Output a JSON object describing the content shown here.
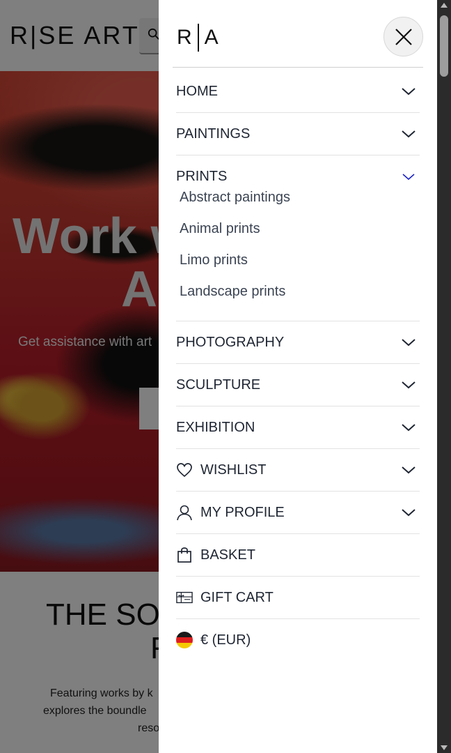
{
  "background": {
    "logo": "R|SE ART",
    "hero": {
      "title_line1": "Work w",
      "title_line2": "A",
      "subtitle": "Get assistance with art"
    },
    "section": {
      "title_line1": "THE SO",
      "title_line2": "F",
      "text_line1": "Featuring works by k",
      "text_line2": "explores the boundle",
      "text_line3": "reso"
    }
  },
  "drawer": {
    "logo_left": "R",
    "logo_right": "A",
    "close_icon": "close-icon",
    "menu": [
      {
        "label": "HOME",
        "icon": null,
        "expandable": true
      },
      {
        "label": "PAINTINGS",
        "icon": null,
        "expandable": true
      },
      {
        "label": "PRINTS",
        "icon": null,
        "expandable": true,
        "expanded": true,
        "children": [
          "Abstract paintings",
          "Animal prints",
          "Limo prints",
          "Landscape prints"
        ]
      },
      {
        "label": "PHOTOGRAPHY",
        "icon": null,
        "expandable": true
      },
      {
        "label": "SCULPTURE",
        "icon": null,
        "expandable": true
      },
      {
        "label": "EXHIBITION",
        "icon": null,
        "expandable": true
      },
      {
        "label": "WISHLIST",
        "icon": "heart-icon",
        "expandable": true
      },
      {
        "label": "MY PROFILE",
        "icon": "user-icon",
        "expandable": true
      },
      {
        "label": "BASKET",
        "icon": "shopping-bag-icon",
        "expandable": false
      },
      {
        "label": "GIFT CART",
        "icon": "gift-card-icon",
        "expandable": false
      },
      {
        "label": "€ (EUR)",
        "icon": "germany-flag-icon",
        "expandable": false
      }
    ]
  },
  "colors": {
    "text": "#1f2633",
    "chevron": "#1f2633",
    "chevron_active": "#1a22c4",
    "divider": "#e2e2e2",
    "overlay": "rgba(0,0,0,0.5)"
  }
}
